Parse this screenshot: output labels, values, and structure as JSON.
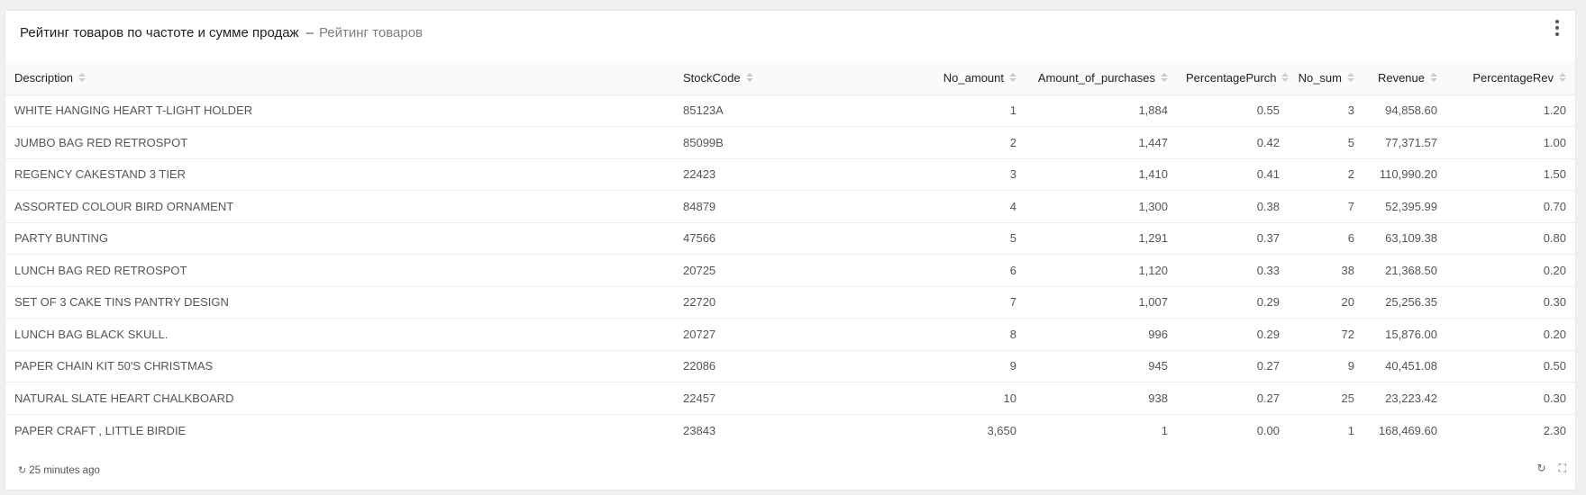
{
  "panel": {
    "title": "Рейтинг товаров по частоте и сумме продаж",
    "separator": "–",
    "viz_name": "Рейтинг товаров"
  },
  "table": {
    "headers": [
      "Description",
      "StockCode",
      "No_amount",
      "Amount_of_purchases",
      "PercentagePurch",
      "No_sum",
      "Revenue",
      "PercentageRev"
    ],
    "rows": [
      [
        "WHITE HANGING HEART T-LIGHT HOLDER",
        "85123A",
        "1",
        "1,884",
        "0.55",
        "3",
        "94,858.60",
        "1.20"
      ],
      [
        "JUMBO BAG RED RETROSPOT",
        "85099B",
        "2",
        "1,447",
        "0.42",
        "5",
        "77,371.57",
        "1.00"
      ],
      [
        "REGENCY CAKESTAND 3 TIER",
        "22423",
        "3",
        "1,410",
        "0.41",
        "2",
        "110,990.20",
        "1.50"
      ],
      [
        "ASSORTED COLOUR BIRD ORNAMENT",
        "84879",
        "4",
        "1,300",
        "0.38",
        "7",
        "52,395.99",
        "0.70"
      ],
      [
        "PARTY BUNTING",
        "47566",
        "5",
        "1,291",
        "0.37",
        "6",
        "63,109.38",
        "0.80"
      ],
      [
        "LUNCH BAG RED RETROSPOT",
        "20725",
        "6",
        "1,120",
        "0.33",
        "38",
        "21,368.50",
        "0.20"
      ],
      [
        "SET OF 3 CAKE TINS PANTRY DESIGN",
        "22720",
        "7",
        "1,007",
        "0.29",
        "20",
        "25,256.35",
        "0.30"
      ],
      [
        "LUNCH BAG BLACK SKULL.",
        "20727",
        "8",
        "996",
        "0.29",
        "72",
        "15,876.00",
        "0.20"
      ],
      [
        "PAPER CHAIN KIT 50'S CHRISTMAS",
        "22086",
        "9",
        "945",
        "0.27",
        "9",
        "40,451.08",
        "0.50"
      ],
      [
        "NATURAL SLATE HEART CHALKBOARD",
        "22457",
        "10",
        "938",
        "0.27",
        "25",
        "23,223.42",
        "0.30"
      ],
      [
        "PAPER CRAFT , LITTLE BIRDIE",
        "23843",
        "3,650",
        "1",
        "0.00",
        "1",
        "168,469.60",
        "2.30"
      ]
    ]
  },
  "footer": {
    "updated": "25 minutes ago"
  },
  "icons": {
    "refresh": "refresh-icon",
    "fullscreen": "fullscreen-icon",
    "menu": "kebab-menu-icon"
  }
}
